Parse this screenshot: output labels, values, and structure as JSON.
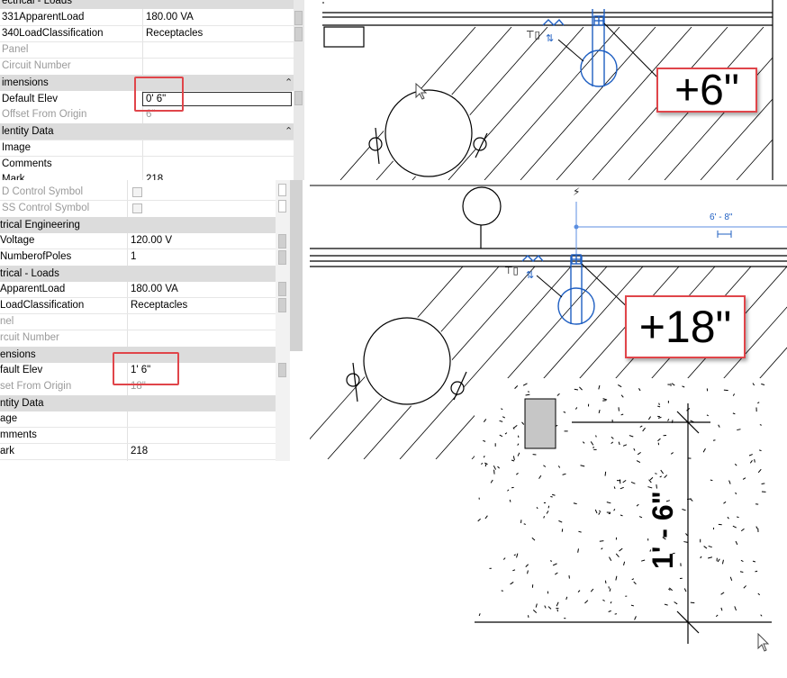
{
  "top_panel": {
    "rows": [
      {
        "key": "ectrical - Loads",
        "value": "",
        "type": "category"
      },
      {
        "key": "331ApparentLoad",
        "value": "180.00 VA",
        "type": "row"
      },
      {
        "key": "340LoadClassification",
        "value": "Receptacles",
        "type": "row"
      },
      {
        "key": "Panel",
        "value": "",
        "type": "grey"
      },
      {
        "key": "Circuit Number",
        "value": "",
        "type": "grey"
      },
      {
        "key": "imensions",
        "value": "",
        "type": "category"
      },
      {
        "key": "Default Elev",
        "value": "0'  6\"",
        "type": "edit"
      },
      {
        "key": "Offset From Origin",
        "value": "6\"",
        "type": "grey"
      },
      {
        "key": "lentity Data",
        "value": "",
        "type": "category"
      },
      {
        "key": "Image",
        "value": "",
        "type": "row"
      },
      {
        "key": "Comments",
        "value": "",
        "type": "row"
      },
      {
        "key": "Mark",
        "value": "218",
        "type": "row"
      }
    ],
    "callout": "+6\""
  },
  "bottom_panel": {
    "rows": [
      {
        "key": "D Control Symbol",
        "value": "",
        "type": "checkbox"
      },
      {
        "key": "SS Control Symbol",
        "value": "",
        "type": "checkbox"
      },
      {
        "key": "trical Engineering",
        "value": "",
        "type": "category"
      },
      {
        "key": "Voltage",
        "value": "120.00 V",
        "type": "row"
      },
      {
        "key": "NumberofPoles",
        "value": "1",
        "type": "row"
      },
      {
        "key": "trical - Loads",
        "value": "",
        "type": "category"
      },
      {
        "key": "ApparentLoad",
        "value": "180.00 VA",
        "type": "row"
      },
      {
        "key": "LoadClassification",
        "value": "Receptacles",
        "type": "row"
      },
      {
        "key": "nel",
        "value": "",
        "type": "grey"
      },
      {
        "key": "rcuit Number",
        "value": "",
        "type": "grey"
      },
      {
        "key": "ensions",
        "value": "",
        "type": "category"
      },
      {
        "key": "fault Elev",
        "value": "1'  6\"",
        "type": "row"
      },
      {
        "key": "set From Origin",
        "value": "18\"",
        "type": "grey"
      },
      {
        "key": "ntity Data",
        "value": "",
        "type": "category"
      },
      {
        "key": "age",
        "value": "",
        "type": "row"
      },
      {
        "key": "mments",
        "value": "",
        "type": "row"
      },
      {
        "key": "ark",
        "value": "218",
        "type": "row"
      }
    ],
    "callout": "+18\"",
    "dimension_label": "6' - 8\""
  },
  "detail_view": {
    "dimension_text": "1' - 6\""
  },
  "colors": {
    "highlight_red": "#e0454a",
    "category_grey": "#dcdcdc",
    "element_blue": "#1f5fc2"
  }
}
